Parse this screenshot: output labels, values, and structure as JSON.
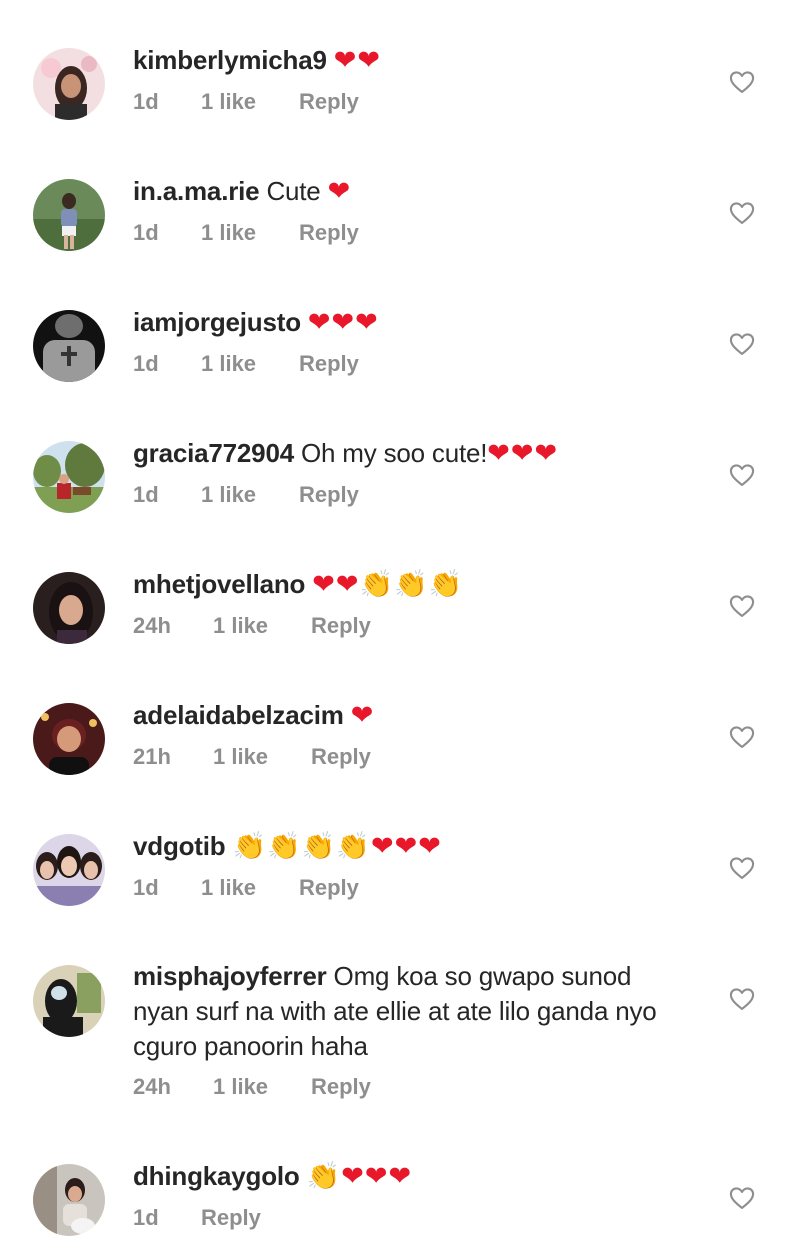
{
  "colors": {
    "text": "#262626",
    "meta": "#8e8e8e",
    "heart_emoji": "#e8172a",
    "clap_emoji": "#f2b81c"
  },
  "comments": [
    {
      "username": "kimberlymicha9",
      "text": "",
      "emojis": "❤❤",
      "time": "1d",
      "likes": "1 like",
      "reply": "Reply"
    },
    {
      "username": "in.a.ma.rie",
      "text": " Cute ",
      "emojis": "❤",
      "time": "1d",
      "likes": "1 like",
      "reply": "Reply"
    },
    {
      "username": "iamjorgejusto",
      "text": " ",
      "emojis": "❤❤❤",
      "time": "1d",
      "likes": "1 like",
      "reply": "Reply"
    },
    {
      "username": "gracia772904",
      "text": " Oh my soo cute!",
      "emojis": "❤❤❤",
      "time": "1d",
      "likes": "1 like",
      "reply": "Reply"
    },
    {
      "username": "mhetjovellano",
      "text": " ",
      "emojis": "❤❤",
      "emojis_clap": "👏👏👏",
      "time": "24h",
      "likes": "1 like",
      "reply": "Reply"
    },
    {
      "username": "adelaidabelzacim",
      "text": " ",
      "emojis": "❤",
      "time": "21h",
      "likes": "1 like",
      "reply": "Reply"
    },
    {
      "username": "vdgotib",
      "text": " ",
      "emojis_clap": "👏👏👏👏",
      "emojis": "❤❤❤",
      "time": "1d",
      "likes": "1 like",
      "reply": "Reply"
    },
    {
      "username": "misphajoyferrer",
      "text": " Omg koa so gwapo sunod nyan surf na with ate ellie at ate lilo ganda nyo cguro panoorin haha",
      "time": "24h",
      "likes": "1 like",
      "reply": "Reply"
    },
    {
      "username": "dhingkaygolo",
      "text": " ",
      "emojis_clap": "👏",
      "emojis": "❤❤❤",
      "time": "1d",
      "reply": "Reply"
    }
  ]
}
